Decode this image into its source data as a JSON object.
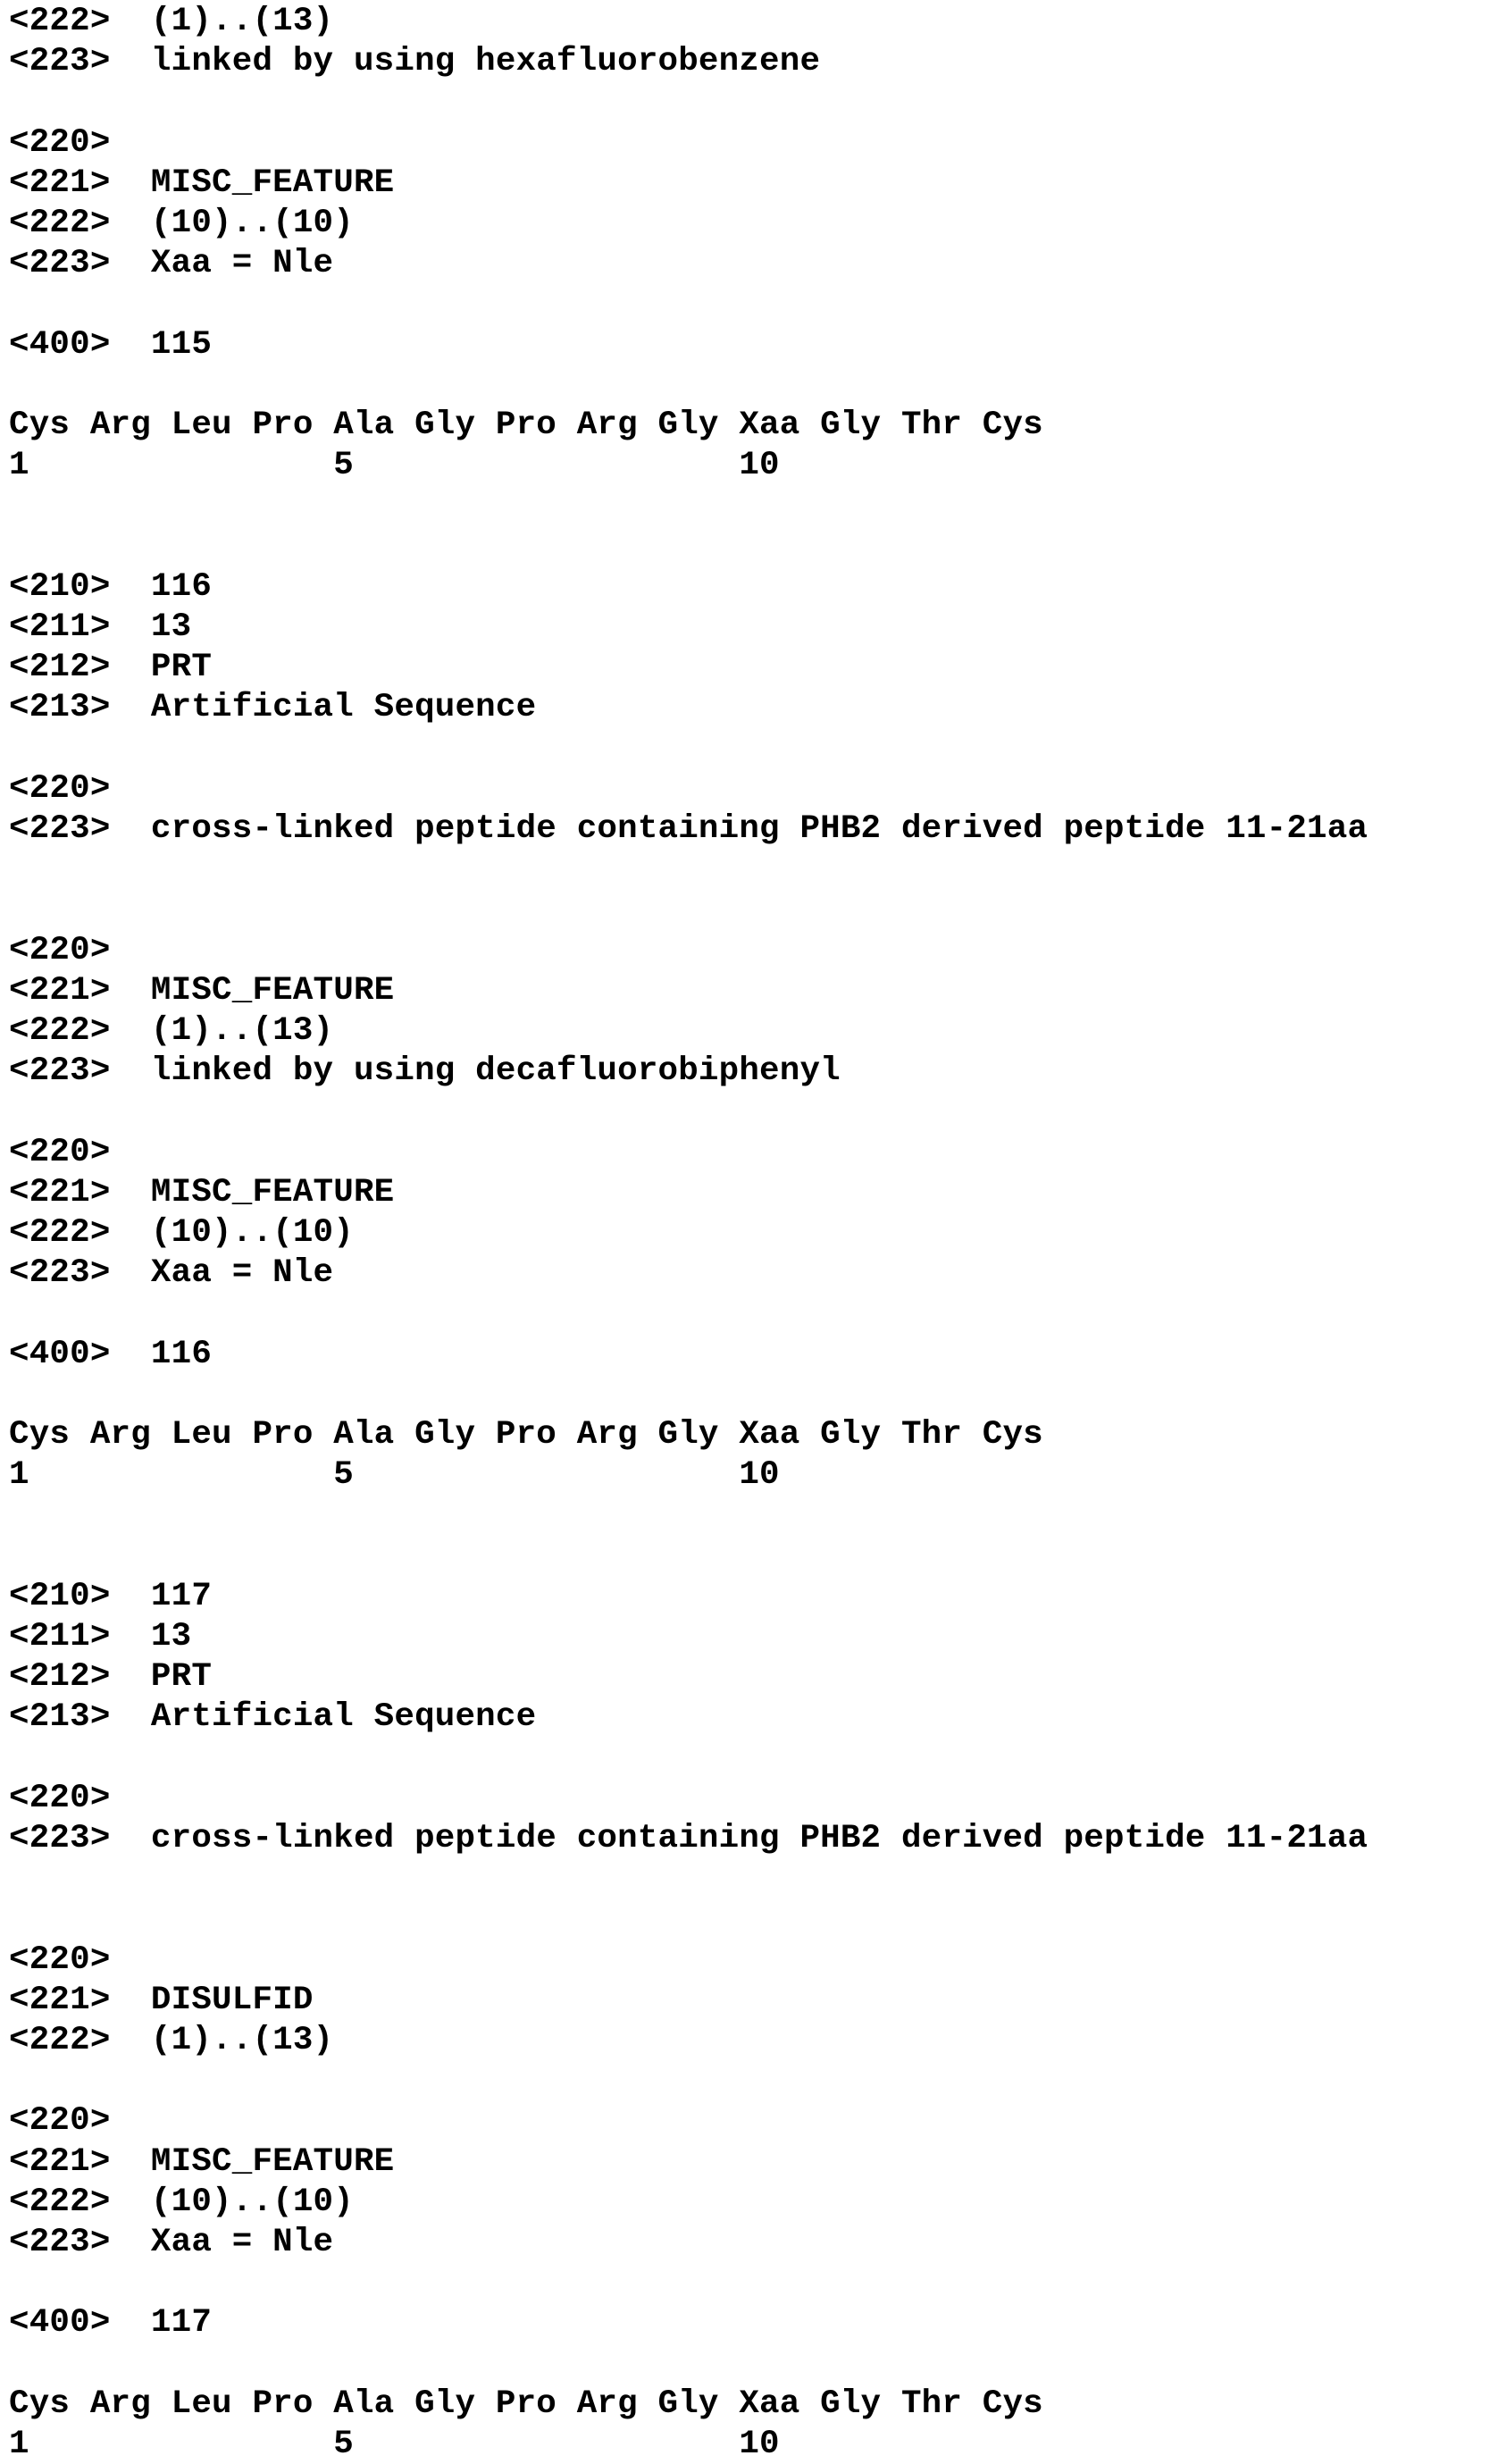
{
  "lines": [
    {
      "text": "<222>  (1)..(13)",
      "row": 0
    },
    {
      "text": "<223>  linked by using hexafluorobenzene",
      "row": 1
    },
    {
      "text": "<220>",
      "row": 3
    },
    {
      "text": "<221>  MISC_FEATURE",
      "row": 4
    },
    {
      "text": "<222>  (10)..(10)",
      "row": 5
    },
    {
      "text": "<223>  Xaa = Nle",
      "row": 6
    },
    {
      "text": "<400>  115",
      "row": 8
    },
    {
      "text": "Cys Arg Leu Pro Ala Gly Pro Arg Gly Xaa Gly Thr Cys",
      "row": 10
    },
    {
      "text": "1               5                   10",
      "row": 11
    },
    {
      "text": "<210>  116",
      "row": 14
    },
    {
      "text": "<211>  13",
      "row": 15
    },
    {
      "text": "<212>  PRT",
      "row": 16
    },
    {
      "text": "<213>  Artificial Sequence",
      "row": 17
    },
    {
      "text": "<220>",
      "row": 19
    },
    {
      "text": "<223>  cross-linked peptide containing PHB2 derived peptide 11-21aa",
      "row": 20
    },
    {
      "text": "<220>",
      "row": 23
    },
    {
      "text": "<221>  MISC_FEATURE",
      "row": 24
    },
    {
      "text": "<222>  (1)..(13)",
      "row": 25
    },
    {
      "text": "<223>  linked by using decafluorobiphenyl",
      "row": 26
    },
    {
      "text": "<220>",
      "row": 28
    },
    {
      "text": "<221>  MISC_FEATURE",
      "row": 29
    },
    {
      "text": "<222>  (10)..(10)",
      "row": 30
    },
    {
      "text": "<223>  Xaa = Nle",
      "row": 31
    },
    {
      "text": "<400>  116",
      "row": 33
    },
    {
      "text": "Cys Arg Leu Pro Ala Gly Pro Arg Gly Xaa Gly Thr Cys",
      "row": 35
    },
    {
      "text": "1               5                   10",
      "row": 36
    },
    {
      "text": "<210>  117",
      "row": 39
    },
    {
      "text": "<211>  13",
      "row": 40
    },
    {
      "text": "<212>  PRT",
      "row": 41
    },
    {
      "text": "<213>  Artificial Sequence",
      "row": 42
    },
    {
      "text": "<220>",
      "row": 44
    },
    {
      "text": "<223>  cross-linked peptide containing PHB2 derived peptide 11-21aa",
      "row": 45
    },
    {
      "text": "<220>",
      "row": 48
    },
    {
      "text": "<221>  DISULFID",
      "row": 49
    },
    {
      "text": "<222>  (1)..(13)",
      "row": 50
    },
    {
      "text": "<220>",
      "row": 52
    },
    {
      "text": "<221>  MISC_FEATURE",
      "row": 53
    },
    {
      "text": "<222>  (10)..(10)",
      "row": 54
    },
    {
      "text": "<223>  Xaa = Nle",
      "row": 55
    },
    {
      "text": "<400>  117",
      "row": 57
    },
    {
      "text": "Cys Arg Leu Pro Ala Gly Pro Arg Gly Xaa Gly Thr Cys",
      "row": 59
    },
    {
      "text": "1               5                   10",
      "row": 60
    }
  ]
}
